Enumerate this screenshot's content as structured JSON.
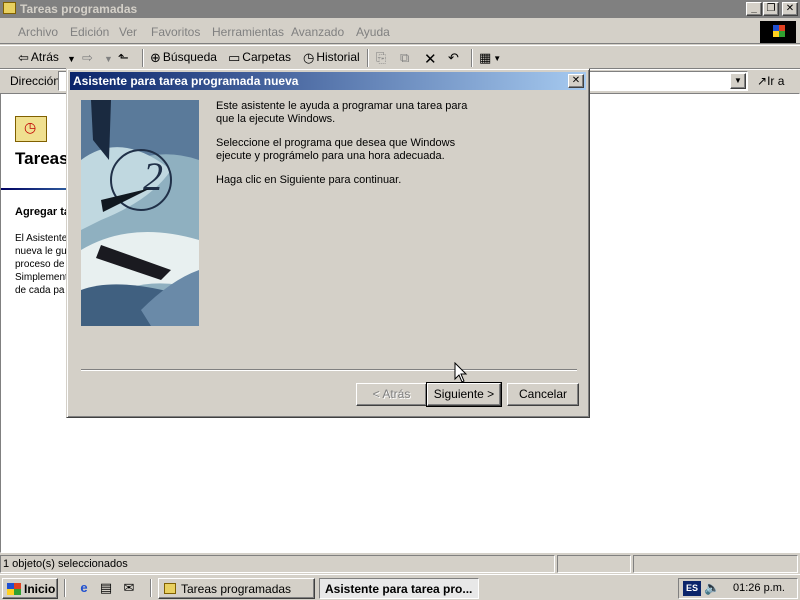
{
  "window": {
    "title": "Tareas programadas",
    "controls": {
      "minimize": "_",
      "maximize": "❐",
      "close": "✕"
    }
  },
  "menu": [
    "Archivo",
    "Edición",
    "Ver",
    "Favoritos",
    "Herramientas",
    "Avanzado",
    "Ayuda"
  ],
  "toolbar": {
    "back": "Atrás",
    "search": "Búsqueda",
    "folders": "Carpetas",
    "history": "Historial"
  },
  "address": {
    "label": "Dirección",
    "value": "",
    "go": "Ir a"
  },
  "folder_view": {
    "title_line1": "Tareas programadas",
    "title_line2": "",
    "subheading": "Agregar tarea programada",
    "desc_lines": [
      "El Asistente",
      "nueva le gu",
      "proceso de",
      "Simplement",
      "de cada pa"
    ]
  },
  "status": {
    "text": "1 objeto(s) seleccionados"
  },
  "dialog": {
    "title": "Asistente para tarea programada nueva",
    "para1": "Este asistente le ayuda a programar una tarea para que la ejecute Windows.",
    "para2": "Seleccione el programa que desea que Windows ejecute y prográmelo para una hora adecuada.",
    "para3": "Haga clic en Siguiente para continuar.",
    "back_button": "< Atrás",
    "next_button": "Siguiente >",
    "cancel_button": "Cancelar"
  },
  "taskbar": {
    "start": "Inicio",
    "tasks": [
      "Tareas programadas",
      "Asistente para tarea pro..."
    ],
    "language": "ES",
    "clock": "01:26 p.m."
  },
  "icons": {
    "app": "folder-clock-icon",
    "back": "back-arrow-icon",
    "forward": "forward-arrow-icon",
    "up": "up-folder-icon",
    "search": "search-icon",
    "folders": "folders-icon",
    "history": "history-icon",
    "move_to": "move-to-icon",
    "copy_to": "copy-to-icon",
    "delete": "delete-icon",
    "undo": "undo-icon",
    "views": "views-icon",
    "go": "go-arrow-icon",
    "ie": "internet-explorer-icon",
    "desktop": "show-desktop-icon",
    "outlook": "outlook-express-icon",
    "volume": "volume-icon"
  }
}
